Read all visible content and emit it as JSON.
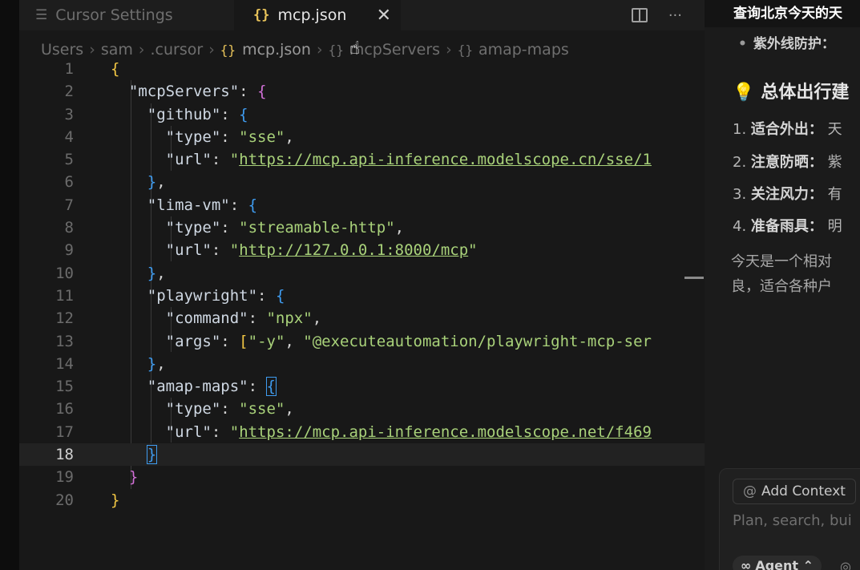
{
  "tabs": {
    "inactive": {
      "icon": "settings-sliders-icon",
      "label": "Cursor Settings"
    },
    "active": {
      "icon": "json-braces-icon",
      "label": "mcp.json",
      "close": "✕"
    },
    "more": "···"
  },
  "breadcrumb": {
    "items": [
      "Users",
      "sam",
      ".cursor"
    ],
    "file": "mcp.json",
    "symbols": [
      "mcpServers",
      "amap-maps"
    ]
  },
  "editor": {
    "current_line": 18,
    "line_numbers": [
      "1",
      "2",
      "3",
      "4",
      "5",
      "6",
      "7",
      "8",
      "9",
      "10",
      "11",
      "12",
      "13",
      "14",
      "15",
      "16",
      "17",
      "18",
      "19",
      "20"
    ],
    "code": {
      "mcpServers_key": "\"mcpServers\"",
      "github_key": "\"github\"",
      "type_key": "\"type\"",
      "url_key": "\"url\"",
      "github_type": "\"sse\"",
      "github_url": "https://mcp.api-inference.modelscope.cn/sse/1",
      "lima_key": "\"lima-vm\"",
      "lima_type": "\"streamable-http\"",
      "lima_url": "http://127.0.0.1:8000/mcp",
      "playwright_key": "\"playwright\"",
      "command_key": "\"command\"",
      "command_val": "\"npx\"",
      "args_key": "\"args\"",
      "args_val1": "\"-y\"",
      "args_val2": "\"@executeautomation/playwright-mcp-ser",
      "amap_key": "\"amap-maps\"",
      "amap_type": "\"sse\"",
      "amap_url": "https://mcp.api-inference.modelscope.net/f469"
    }
  },
  "chat": {
    "title": "查询北京今天的天",
    "bullet": "紫外线防护：",
    "heading": "总体出行建",
    "items": [
      {
        "num": "1.",
        "label": "适合外出：",
        "text": "天"
      },
      {
        "num": "2.",
        "label": "注意防晒：",
        "text": "紫"
      },
      {
        "num": "3.",
        "label": "关注风力：",
        "text": "有"
      },
      {
        "num": "4.",
        "label": "准备雨具：",
        "text": "明"
      }
    ],
    "paragraph": [
      "今天是一个相对",
      "良，适合各种户"
    ],
    "add_context": "Add Context",
    "placeholder": "Plan, search, bui",
    "agent_label": "Agent"
  }
}
